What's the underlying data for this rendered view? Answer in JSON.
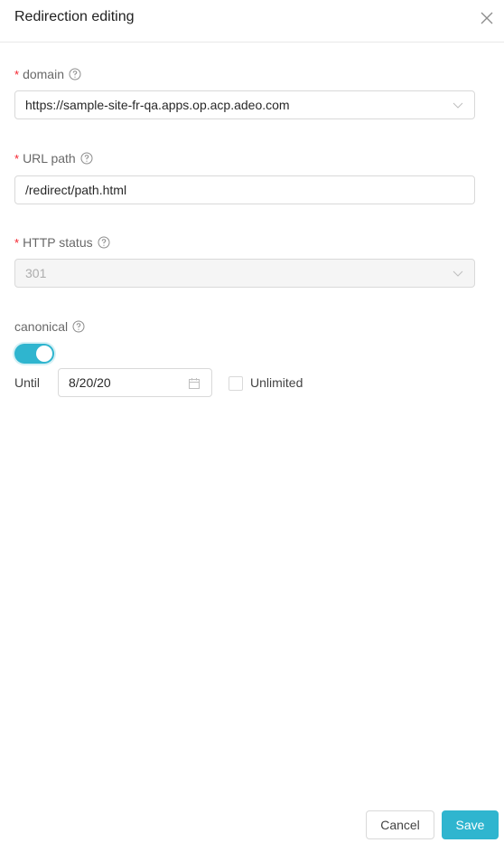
{
  "header": {
    "title": "Redirection editing",
    "close_icon": "close-icon"
  },
  "form": {
    "domain": {
      "label": "domain",
      "required": true,
      "value": "https://sample-site-fr-qa.apps.op.acp.adeo.com"
    },
    "url_path": {
      "label": "URL path",
      "required": true,
      "value": "/redirect/path.html"
    },
    "http_status": {
      "label": "HTTP status",
      "required": true,
      "value": "301",
      "disabled": true
    },
    "canonical": {
      "label": "canonical",
      "required": false,
      "enabled": true
    },
    "until": {
      "label": "Until",
      "value": "8/20/20"
    },
    "unlimited": {
      "label": "Unlimited",
      "checked": false
    },
    "required_marker": "*"
  },
  "footer": {
    "cancel_label": "Cancel",
    "save_label": "Save"
  },
  "colors": {
    "accent": "#2fb5cf",
    "required": "#f5222d"
  }
}
